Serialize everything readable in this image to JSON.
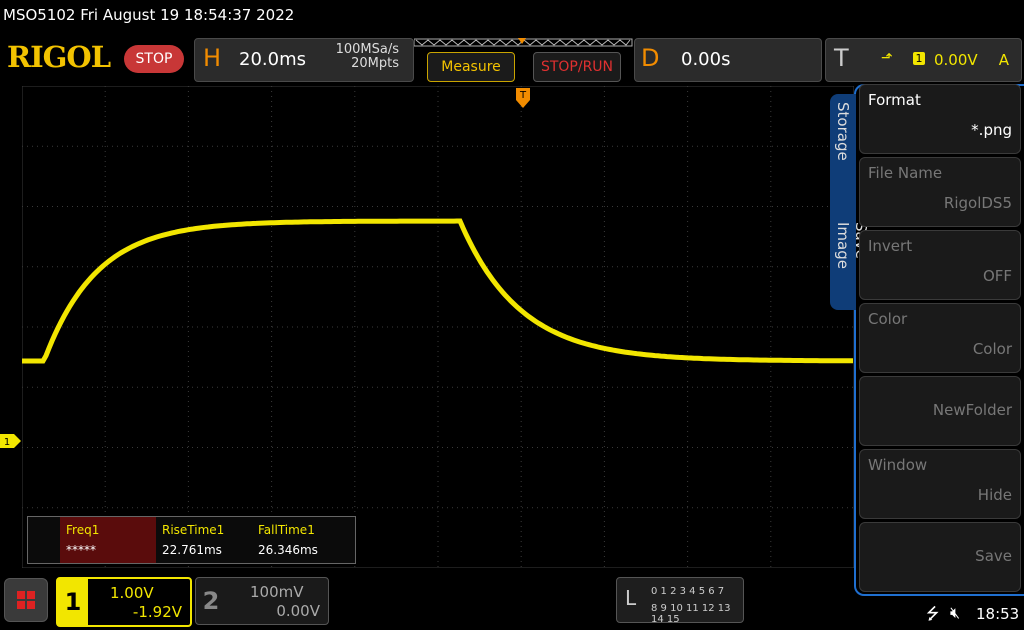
{
  "title": "MSO5102  Fri August 19 18:54:37 2022",
  "brand": "RIGOL",
  "run_state": "STOP",
  "horizontal": {
    "letter": "H",
    "timebase": "20.0ms",
    "sample_rate": "100MSa/s",
    "memory_depth": "20Mpts"
  },
  "buttons": {
    "measure": "Measure",
    "stop_run": "STOP/RUN"
  },
  "delay": {
    "letter": "D",
    "value": "0.00s"
  },
  "trigger": {
    "letter": "T",
    "channel": "1",
    "level": "0.00V",
    "mode": "A",
    "edge_icon": "rising-edge-icon",
    "marker": "T"
  },
  "channel_marker": "1",
  "measurements": {
    "headers": [
      "Freq1",
      "RiseTime1",
      "FallTime1"
    ],
    "values": [
      "*****",
      "22.761ms",
      "26.346ms"
    ]
  },
  "channels": [
    {
      "num": "1",
      "scale": "1.00V",
      "offset": "-1.92V",
      "active": true,
      "color": "#f2e600"
    },
    {
      "num": "2",
      "scale": "100mV",
      "offset": "0.00V",
      "active": false
    }
  ],
  "logic": {
    "letter": "L",
    "row1": "0 1 2 3  4 5 6 7",
    "row2": "8 9 10 11 12 13 14 15"
  },
  "status": {
    "time": "18:53",
    "usb_icon": "usb-icon",
    "sound_icon": "mute-icon"
  },
  "side_menu": {
    "tabs": [
      "Storage",
      "Save Image"
    ],
    "items": [
      {
        "label": "Format",
        "value": "*.png",
        "enabled": true
      },
      {
        "label": "File Name",
        "value": "RigolDS5",
        "enabled": false
      },
      {
        "label": "Invert",
        "value": "OFF",
        "enabled": false
      },
      {
        "label": "Color",
        "value": "Color",
        "enabled": false
      },
      {
        "label": "",
        "value": "NewFolder",
        "enabled": false
      },
      {
        "label": "Window",
        "value": "Hide",
        "enabled": false
      },
      {
        "label": "",
        "value": "Save",
        "enabled": false
      }
    ]
  },
  "colors": {
    "trace": "#f2e600",
    "accent": "#f28c00",
    "menu_border": "#1f6fd0"
  }
}
